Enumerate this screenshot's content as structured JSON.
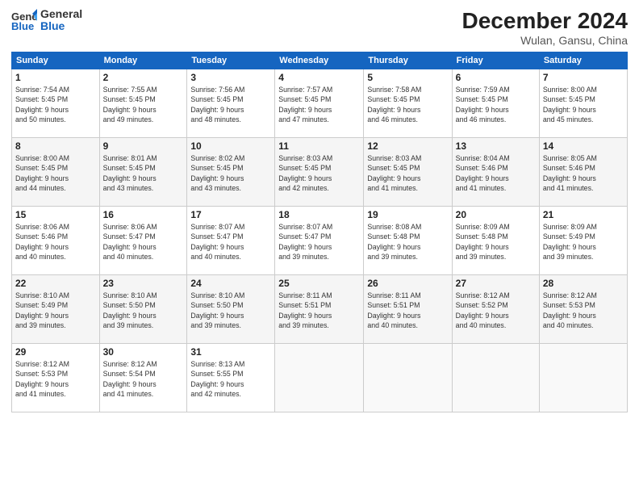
{
  "logo": {
    "line1": "General",
    "line2": "Blue"
  },
  "header": {
    "month": "December 2024",
    "location": "Wulan, Gansu, China"
  },
  "weekdays": [
    "Sunday",
    "Monday",
    "Tuesday",
    "Wednesday",
    "Thursday",
    "Friday",
    "Saturday"
  ],
  "weeks": [
    [
      {
        "day": 1,
        "sunrise": "7:54 AM",
        "sunset": "5:45 PM",
        "daylight": "9 hours and 50 minutes."
      },
      {
        "day": 2,
        "sunrise": "7:55 AM",
        "sunset": "5:45 PM",
        "daylight": "9 hours and 49 minutes."
      },
      {
        "day": 3,
        "sunrise": "7:56 AM",
        "sunset": "5:45 PM",
        "daylight": "9 hours and 48 minutes."
      },
      {
        "day": 4,
        "sunrise": "7:57 AM",
        "sunset": "5:45 PM",
        "daylight": "9 hours and 47 minutes."
      },
      {
        "day": 5,
        "sunrise": "7:58 AM",
        "sunset": "5:45 PM",
        "daylight": "9 hours and 46 minutes."
      },
      {
        "day": 6,
        "sunrise": "7:59 AM",
        "sunset": "5:45 PM",
        "daylight": "9 hours and 46 minutes."
      },
      {
        "day": 7,
        "sunrise": "8:00 AM",
        "sunset": "5:45 PM",
        "daylight": "9 hours and 45 minutes."
      }
    ],
    [
      {
        "day": 8,
        "sunrise": "8:00 AM",
        "sunset": "5:45 PM",
        "daylight": "9 hours and 44 minutes."
      },
      {
        "day": 9,
        "sunrise": "8:01 AM",
        "sunset": "5:45 PM",
        "daylight": "9 hours and 43 minutes."
      },
      {
        "day": 10,
        "sunrise": "8:02 AM",
        "sunset": "5:45 PM",
        "daylight": "9 hours and 43 minutes."
      },
      {
        "day": 11,
        "sunrise": "8:03 AM",
        "sunset": "5:45 PM",
        "daylight": "9 hours and 42 minutes."
      },
      {
        "day": 12,
        "sunrise": "8:03 AM",
        "sunset": "5:45 PM",
        "daylight": "9 hours and 41 minutes."
      },
      {
        "day": 13,
        "sunrise": "8:04 AM",
        "sunset": "5:46 PM",
        "daylight": "9 hours and 41 minutes."
      },
      {
        "day": 14,
        "sunrise": "8:05 AM",
        "sunset": "5:46 PM",
        "daylight": "9 hours and 41 minutes."
      }
    ],
    [
      {
        "day": 15,
        "sunrise": "8:06 AM",
        "sunset": "5:46 PM",
        "daylight": "9 hours and 40 minutes."
      },
      {
        "day": 16,
        "sunrise": "8:06 AM",
        "sunset": "5:47 PM",
        "daylight": "9 hours and 40 minutes."
      },
      {
        "day": 17,
        "sunrise": "8:07 AM",
        "sunset": "5:47 PM",
        "daylight": "9 hours and 40 minutes."
      },
      {
        "day": 18,
        "sunrise": "8:07 AM",
        "sunset": "5:47 PM",
        "daylight": "9 hours and 39 minutes."
      },
      {
        "day": 19,
        "sunrise": "8:08 AM",
        "sunset": "5:48 PM",
        "daylight": "9 hours and 39 minutes."
      },
      {
        "day": 20,
        "sunrise": "8:09 AM",
        "sunset": "5:48 PM",
        "daylight": "9 hours and 39 minutes."
      },
      {
        "day": 21,
        "sunrise": "8:09 AM",
        "sunset": "5:49 PM",
        "daylight": "9 hours and 39 minutes."
      }
    ],
    [
      {
        "day": 22,
        "sunrise": "8:10 AM",
        "sunset": "5:49 PM",
        "daylight": "9 hours and 39 minutes."
      },
      {
        "day": 23,
        "sunrise": "8:10 AM",
        "sunset": "5:50 PM",
        "daylight": "9 hours and 39 minutes."
      },
      {
        "day": 24,
        "sunrise": "8:10 AM",
        "sunset": "5:50 PM",
        "daylight": "9 hours and 39 minutes."
      },
      {
        "day": 25,
        "sunrise": "8:11 AM",
        "sunset": "5:51 PM",
        "daylight": "9 hours and 39 minutes."
      },
      {
        "day": 26,
        "sunrise": "8:11 AM",
        "sunset": "5:51 PM",
        "daylight": "9 hours and 40 minutes."
      },
      {
        "day": 27,
        "sunrise": "8:12 AM",
        "sunset": "5:52 PM",
        "daylight": "9 hours and 40 minutes."
      },
      {
        "day": 28,
        "sunrise": "8:12 AM",
        "sunset": "5:53 PM",
        "daylight": "9 hours and 40 minutes."
      }
    ],
    [
      {
        "day": 29,
        "sunrise": "8:12 AM",
        "sunset": "5:53 PM",
        "daylight": "9 hours and 41 minutes."
      },
      {
        "day": 30,
        "sunrise": "8:12 AM",
        "sunset": "5:54 PM",
        "daylight": "9 hours and 41 minutes."
      },
      {
        "day": 31,
        "sunrise": "8:13 AM",
        "sunset": "5:55 PM",
        "daylight": "9 hours and 42 minutes."
      },
      null,
      null,
      null,
      null
    ]
  ]
}
